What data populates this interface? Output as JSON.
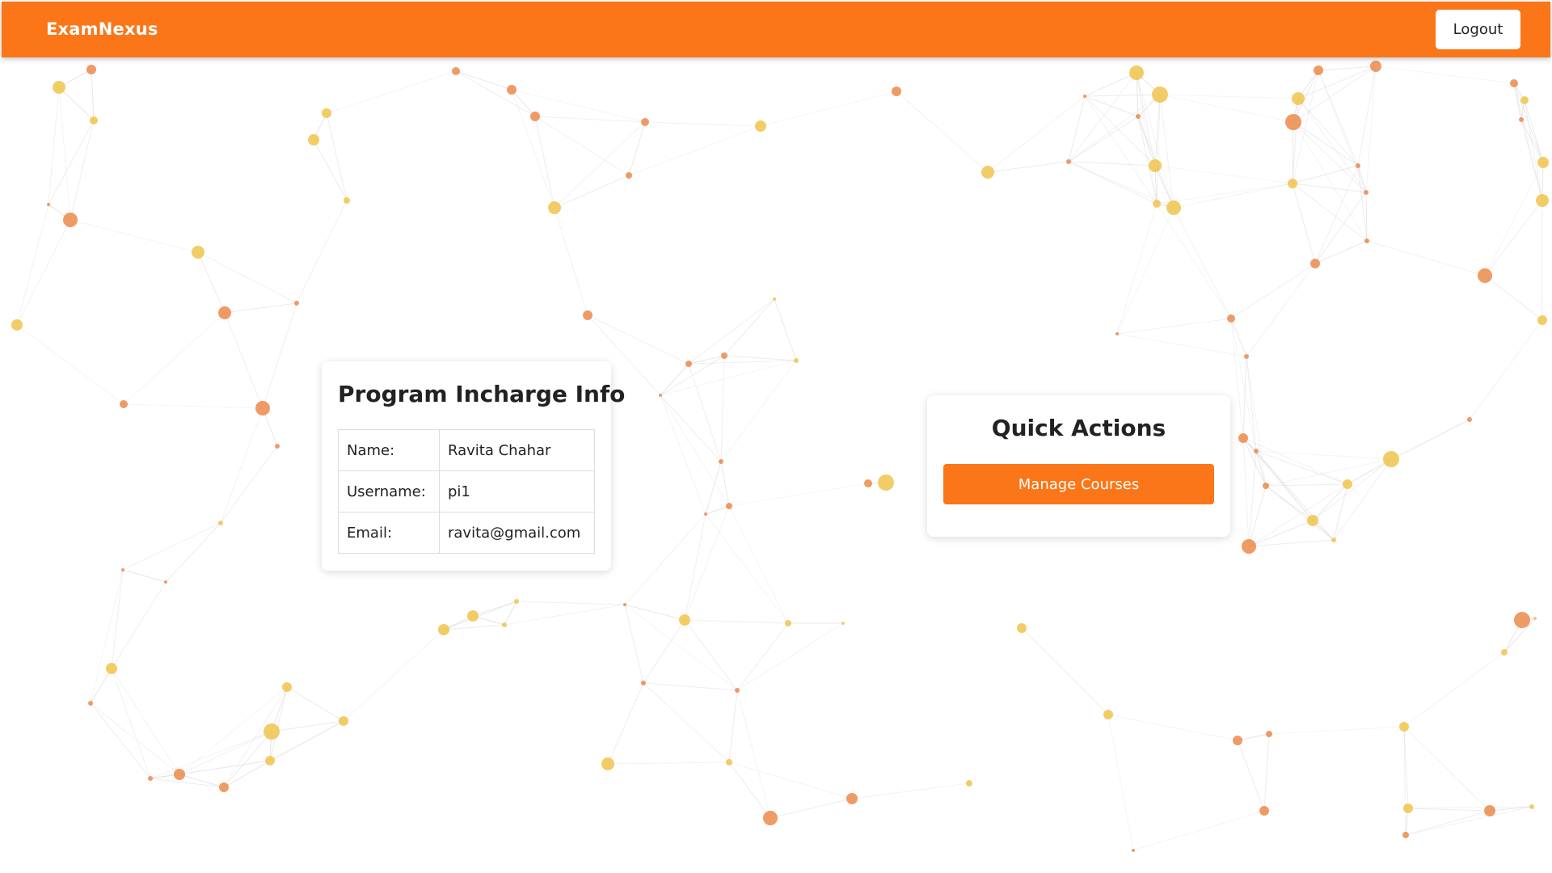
{
  "navbar": {
    "brand": "ExamNexus",
    "logout_label": "Logout"
  },
  "info_card": {
    "title": "Program Incharge Info",
    "rows": [
      {
        "label": "Name:",
        "value": "Ravita Chahar"
      },
      {
        "label": "Username:",
        "value": "pi1"
      },
      {
        "label": "Email:",
        "value": "ravita@gmail.com"
      }
    ]
  },
  "actions_card": {
    "title": "Quick Actions",
    "manage_courses_label": "Manage Courses"
  },
  "colors": {
    "primary": "#fa7619",
    "node_yellow": "#f0c44c",
    "node_orange": "#ec8a4a",
    "link_line": "#d9d9d9"
  }
}
